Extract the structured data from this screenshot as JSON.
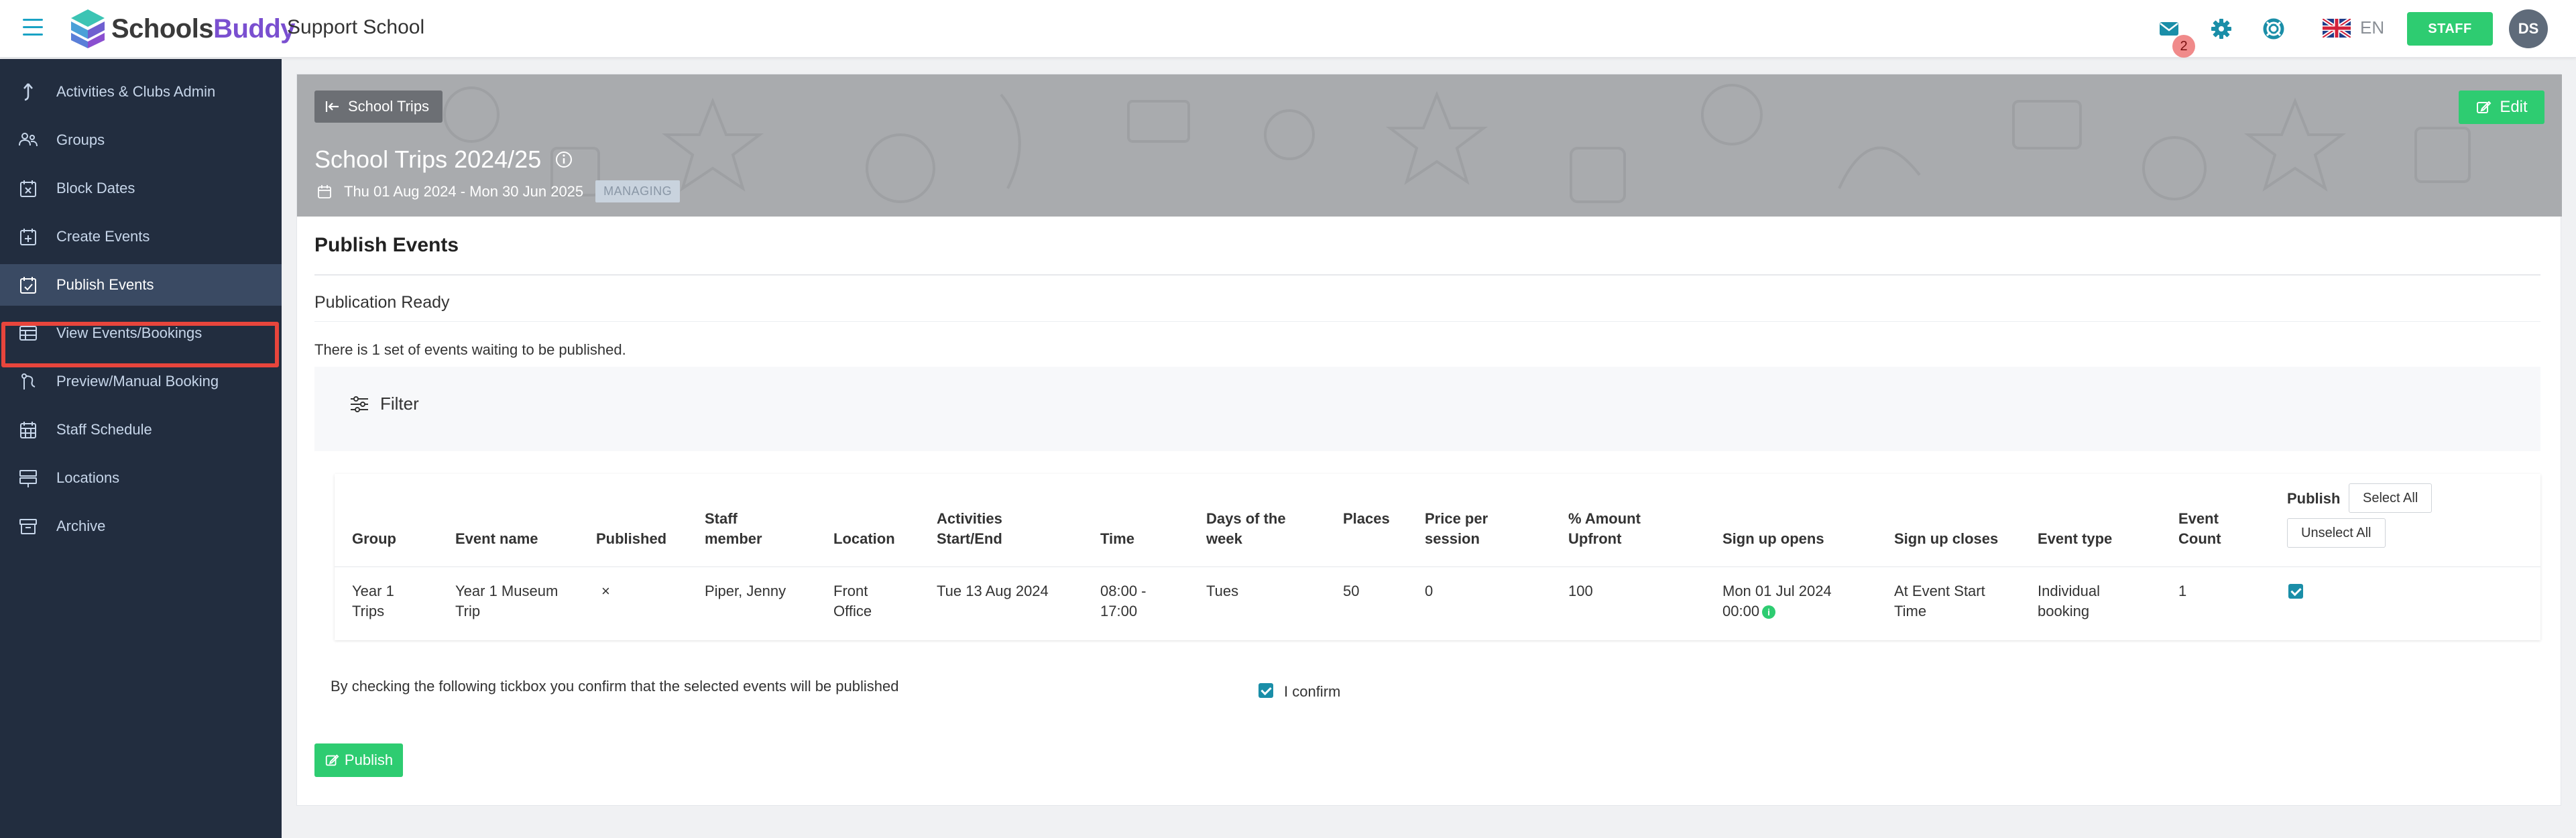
{
  "header": {
    "logo_part1": "Schools",
    "logo_part2": "Buddy",
    "school_name": "Support School",
    "notifications_count": "2",
    "language": "EN",
    "role_button": "STAFF",
    "avatar_initials": "DS"
  },
  "sidebar": {
    "items": [
      {
        "label": "Activities & Clubs Admin",
        "icon": "arrow-up-icon"
      },
      {
        "label": "Groups",
        "icon": "users-icon"
      },
      {
        "label": "Block Dates",
        "icon": "calendar-x-icon"
      },
      {
        "label": "Create Events",
        "icon": "calendar-plus-icon"
      },
      {
        "label": "Publish Events",
        "icon": "calendar-check-icon",
        "active": true
      },
      {
        "label": "View Events/Bookings",
        "icon": "table-icon"
      },
      {
        "label": "Preview/Manual Booking",
        "icon": "route-icon"
      },
      {
        "label": "Staff Schedule",
        "icon": "grid-calendar-icon"
      },
      {
        "label": "Locations",
        "icon": "signpost-icon"
      },
      {
        "label": "Archive",
        "icon": "archive-icon"
      }
    ]
  },
  "hero": {
    "back_label": "School Trips",
    "edit_label": "Edit",
    "title": "School Trips 2024/25",
    "date_range": "Thu 01 Aug 2024 - Mon 30 Jun 2025",
    "status_tag": "MANAGING"
  },
  "main": {
    "section_title": "Publish Events",
    "subtitle": "Publication Ready",
    "waiting_text": "There is 1 set of events waiting to be published.",
    "filter_label": "Filter",
    "confirm_text": "By checking the following tickbox you confirm that the selected events will be published",
    "confirm_label": "I confirm",
    "publish_button": "Publish"
  },
  "table": {
    "headers": {
      "group": "Group",
      "event_name": "Event name",
      "published": "Published",
      "staff_1": "Staff",
      "staff_2": "member",
      "location": "Location",
      "activities_1": "Activities",
      "activities_2": "Start/End",
      "time": "Time",
      "days_1": "Days of the",
      "days_2": "week",
      "places": "Places",
      "price_1": "Price per",
      "price_2": "session",
      "amount_1": "% Amount",
      "amount_2": "Upfront",
      "signup_opens": "Sign up opens",
      "signup_closes": "Sign up closes",
      "event_type": "Event type",
      "count_1": "Event",
      "count_2": "Count",
      "publish": "Publish",
      "select_all": "Select All",
      "unselect_all": "Unselect All"
    },
    "rows": [
      {
        "group_1": "Year 1",
        "group_2": "Trips",
        "event_name_1": "Year 1 Museum",
        "event_name_2": "Trip",
        "published": "×",
        "staff": "Piper, Jenny",
        "location_1": "Front",
        "location_2": "Office",
        "activities": "Tue 13 Aug 2024",
        "time_1": "08:00 -",
        "time_2": "17:00",
        "days": "Tues",
        "places": "50",
        "price": "0",
        "amount": "100",
        "signup_opens_1": "Mon 01 Jul 2024",
        "signup_opens_2": "00:00",
        "signup_closes_1": "At Event Start",
        "signup_closes_2": "Time",
        "event_type_1": "Individual",
        "event_type_2": "booking",
        "count": "1",
        "selected": true
      }
    ]
  },
  "colors": {
    "sidebar_bg": "#222d3f",
    "sidebar_active": "#3a4a63",
    "accent_green": "#2ecc71",
    "accent_teal": "#19a2c4",
    "highlight_red": "#e8453c"
  }
}
